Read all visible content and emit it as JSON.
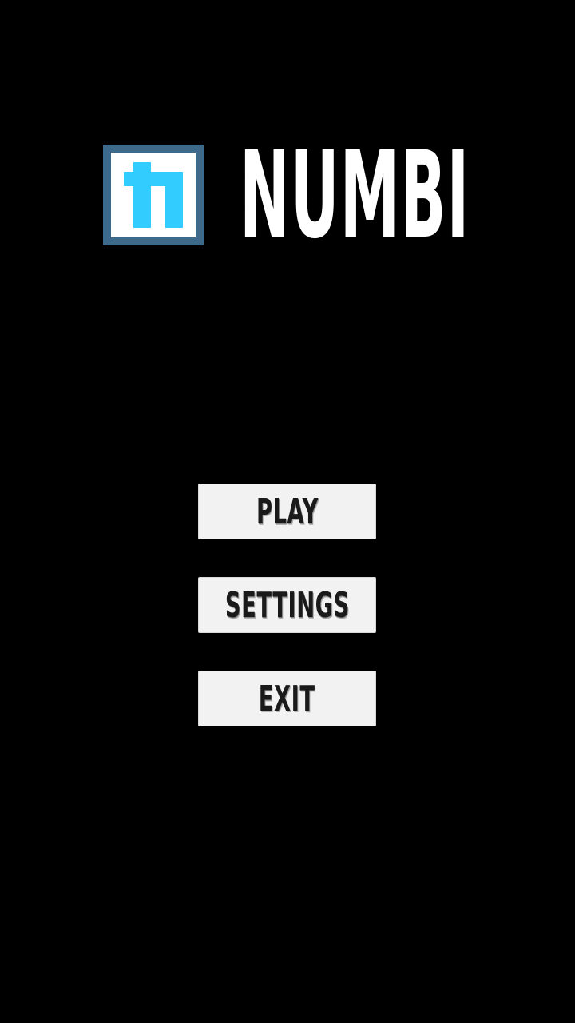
{
  "app": {
    "title": "NUMBI",
    "logo_icon": "numbi-n-logo-icon",
    "colors": {
      "background": "#000000",
      "logo_border": "#3d6a8a",
      "logo_inner": "#ffffff",
      "logo_glyph": "#33ccff",
      "title_text": "#ffffff",
      "button_bg": "#f2f2f2",
      "button_text": "#1a1a1a"
    }
  },
  "menu": {
    "play_label": "PLAY",
    "settings_label": "SETTINGS",
    "exit_label": "EXIT"
  }
}
